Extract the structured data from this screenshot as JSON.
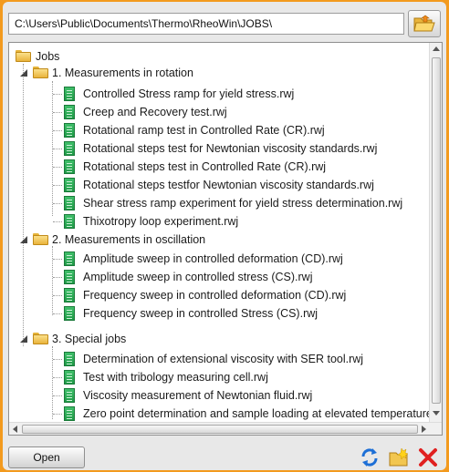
{
  "path": {
    "value": "C:\\Users\\Public\\Documents\\Thermo\\RheoWin\\JOBS\\"
  },
  "tree": {
    "root": "Jobs",
    "groups": [
      {
        "label": "1. Measurements in rotation",
        "items": [
          "Controlled Stress ramp for yield stress.rwj",
          "Creep and Recovery test.rwj",
          "Rotational ramp test in Controlled Rate (CR).rwj",
          "Rotational steps test for Newtonian viscosity standards.rwj",
          "Rotational steps test in Controlled Rate (CR).rwj",
          "Rotational steps testfor Newtonian viscosity standards.rwj",
          "Shear stress ramp experiment for yield stress determination.rwj",
          "Thixotropy loop experiment.rwj"
        ]
      },
      {
        "label": "2. Measurements in oscillation",
        "items": [
          "Amplitude sweep in controlled deformation (CD).rwj",
          "Amplitude sweep in controlled stress (CS).rwj",
          "Frequency sweep in controlled deformation (CD).rwj",
          "Frequency sweep in controlled Stress (CS).rwj"
        ]
      },
      {
        "label": "3. Special jobs",
        "items": [
          "Determination of extensional viscosity with SER tool.rwj",
          "Test with tribology measuring cell.rwj",
          "Viscosity measurement of Newtonian fluid.rwj",
          "Zero point determination and sample loading at elevated temperature.rwj"
        ]
      }
    ]
  },
  "buttons": {
    "open": "Open"
  },
  "icons": {
    "browse": "open-folder-icon",
    "refresh": "refresh-icon",
    "new_folder": "new-folder-icon",
    "delete": "delete-icon"
  },
  "colors": {
    "frame": "#f39a1e",
    "file": "#2aa955",
    "folder": "#f0c24c"
  }
}
